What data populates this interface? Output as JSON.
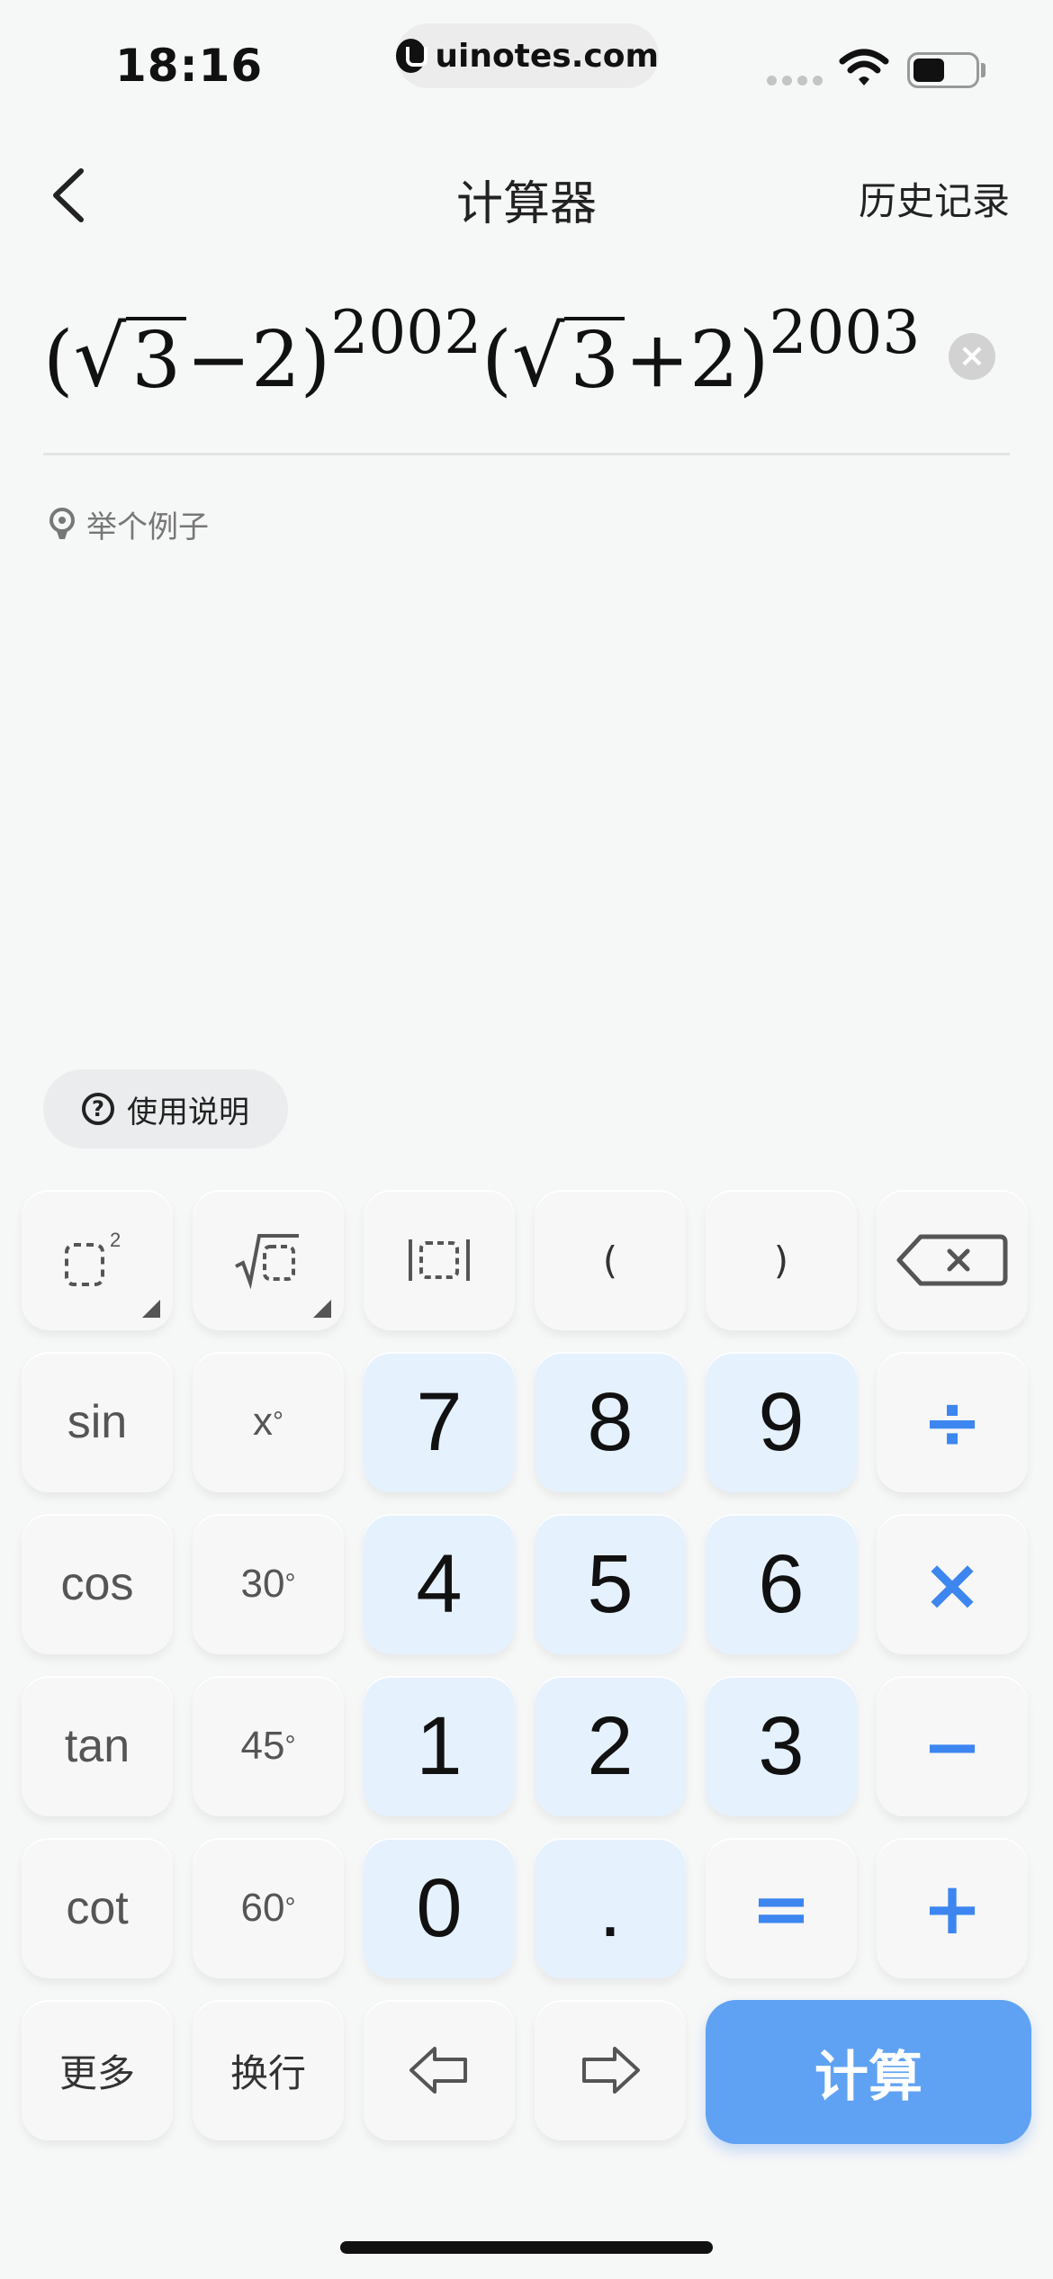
{
  "status_bar": {
    "time": "18:16",
    "url": "uinotes.com"
  },
  "nav": {
    "title": "计算器",
    "history": "历史记录"
  },
  "expression": {
    "part1_open": "(",
    "sqrt1": "3",
    "part1_rest": "−2)",
    "exp1": "2002",
    "part2_open": "(",
    "sqrt2": "3",
    "part2_rest": "+2)",
    "exp2": "2003"
  },
  "clear_label": "×",
  "example": "举个例子",
  "help": "使用说明",
  "keys": {
    "paren_open": "(",
    "paren_close": ")",
    "sin": "sin",
    "x_deg": "x",
    "deg_symbol": "°",
    "cos": "cos",
    "deg30": "30",
    "tan": "tan",
    "deg45": "45",
    "cot": "cot",
    "deg60": "60",
    "n7": "7",
    "n8": "8",
    "n9": "9",
    "n4": "4",
    "n5": "5",
    "n6": "6",
    "n1": "1",
    "n2": "2",
    "n3": "3",
    "n0": "0",
    "dot": ".",
    "divide": "÷",
    "multiply": "×",
    "minus": "−",
    "plus": "+",
    "equals": "=",
    "more": "更多",
    "newline": "换行",
    "calculate": "计算"
  },
  "colors": {
    "accent": "#3d86f0",
    "calc_button": "#5fa2f3",
    "num_key": "#e5f1fd"
  }
}
